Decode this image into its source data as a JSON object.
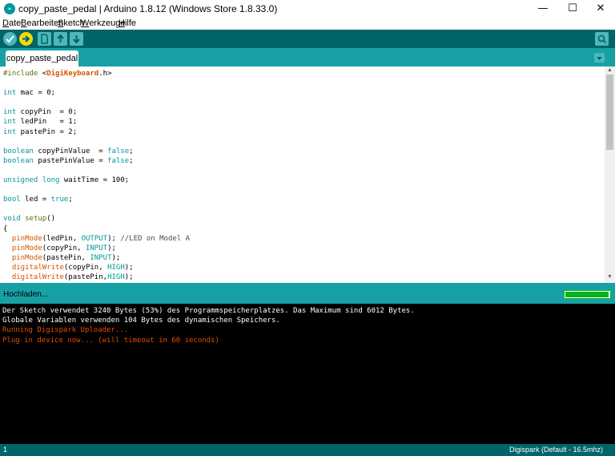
{
  "window": {
    "title": "copy_paste_pedal | Arduino 1.8.12 (Windows Store 1.8.33.0)",
    "app_icon_text": "∞",
    "minimize": "—",
    "maximize": "☐",
    "close": "✕"
  },
  "menu": {
    "items": [
      {
        "pre": "",
        "u": "D",
        "post": "atei"
      },
      {
        "pre": "",
        "u": "B",
        "post": "earbeiten"
      },
      {
        "pre": "",
        "u": "S",
        "post": "ketch"
      },
      {
        "pre": "",
        "u": "W",
        "post": "erkzeuge"
      },
      {
        "pre": "",
        "u": "H",
        "post": "ilfe"
      }
    ]
  },
  "toolbar": {
    "verify": "verify-icon",
    "upload": "upload-arrow-icon",
    "new": "new-file-icon",
    "open": "open-arrow-up-icon",
    "save": "save-arrow-down-icon",
    "serial_monitor": "magnifier-icon"
  },
  "tabs": [
    {
      "label": "copy_paste_pedal"
    }
  ],
  "editor": {
    "lines": [
      [
        {
          "t": "#include ",
          "c": "inc"
        },
        {
          "t": "<",
          "c": ""
        },
        {
          "t": "DigiKeyboard",
          "c": "lib"
        },
        {
          "t": ".h>",
          "c": ""
        }
      ],
      [],
      [
        {
          "t": "int",
          "c": "ty"
        },
        {
          "t": " mac = 0;",
          "c": ""
        }
      ],
      [],
      [
        {
          "t": "int",
          "c": "ty"
        },
        {
          "t": " copyPin  = 0;",
          "c": ""
        }
      ],
      [
        {
          "t": "int",
          "c": "ty"
        },
        {
          "t": " ledPin   = 1;",
          "c": ""
        }
      ],
      [
        {
          "t": "int",
          "c": "ty"
        },
        {
          "t": " pastePin = 2;",
          "c": ""
        }
      ],
      [],
      [
        {
          "t": "boolean",
          "c": "ty"
        },
        {
          "t": " copyPinValue  = ",
          "c": ""
        },
        {
          "t": "false",
          "c": "lit"
        },
        {
          "t": ";",
          "c": ""
        }
      ],
      [
        {
          "t": "boolean",
          "c": "ty"
        },
        {
          "t": " pastePinValue = ",
          "c": ""
        },
        {
          "t": "false",
          "c": "lit"
        },
        {
          "t": ";",
          "c": ""
        }
      ],
      [],
      [
        {
          "t": "unsigned",
          "c": "ty"
        },
        {
          "t": " ",
          "c": ""
        },
        {
          "t": "long",
          "c": "ty"
        },
        {
          "t": " waitTime = 100;",
          "c": ""
        }
      ],
      [],
      [
        {
          "t": "bool",
          "c": "ty"
        },
        {
          "t": " led = ",
          "c": ""
        },
        {
          "t": "true",
          "c": "lit"
        },
        {
          "t": ";",
          "c": ""
        }
      ],
      [],
      [
        {
          "t": "void",
          "c": "ty"
        },
        {
          "t": " ",
          "c": ""
        },
        {
          "t": "setup",
          "c": "inc"
        },
        {
          "t": "()",
          "c": ""
        }
      ],
      [
        {
          "t": "{",
          "c": ""
        }
      ],
      [
        {
          "t": "  ",
          "c": ""
        },
        {
          "t": "pinMode",
          "c": "fn"
        },
        {
          "t": "(ledPin, ",
          "c": ""
        },
        {
          "t": "OUTPUT",
          "c": "lit"
        },
        {
          "t": "); ",
          "c": ""
        },
        {
          "t": "//LED on Model A",
          "c": "cm"
        }
      ],
      [
        {
          "t": "  ",
          "c": ""
        },
        {
          "t": "pinMode",
          "c": "fn"
        },
        {
          "t": "(copyPin, ",
          "c": ""
        },
        {
          "t": "INPUT",
          "c": "lit"
        },
        {
          "t": ");",
          "c": ""
        }
      ],
      [
        {
          "t": "  ",
          "c": ""
        },
        {
          "t": "pinMode",
          "c": "fn"
        },
        {
          "t": "(pastePin, ",
          "c": ""
        },
        {
          "t": "INPUT",
          "c": "lit"
        },
        {
          "t": ");",
          "c": ""
        }
      ],
      [
        {
          "t": "  ",
          "c": ""
        },
        {
          "t": "digitalWrite",
          "c": "fn"
        },
        {
          "t": "(copyPin, ",
          "c": ""
        },
        {
          "t": "HIGH",
          "c": "lit"
        },
        {
          "t": ");",
          "c": ""
        }
      ],
      [
        {
          "t": "  ",
          "c": ""
        },
        {
          "t": "digitalWrite",
          "c": "fn"
        },
        {
          "t": "(pastePin,",
          "c": ""
        },
        {
          "t": "HIGH",
          "c": "lit"
        },
        {
          "t": ");",
          "c": ""
        }
      ]
    ]
  },
  "status": {
    "text": "Hochladen...",
    "progress": 0.98
  },
  "console": {
    "lines": [
      {
        "t": "Der Sketch verwendet 3240 Bytes (53%) des Programmspeicherplatzes. Das Maximum sind 6012 Bytes.",
        "c": "w"
      },
      {
        "t": "Globale Variablen verwenden 104 Bytes des dynamischen Speichers.",
        "c": "w"
      },
      {
        "t": "Running Digispark Uploader...",
        "c": "r"
      },
      {
        "t": "Plug in device now... (will timeout in 60 seconds)",
        "c": "r"
      }
    ]
  },
  "footer": {
    "line_number": "1",
    "board": "Digispark (Default - 16.5mhz)"
  }
}
